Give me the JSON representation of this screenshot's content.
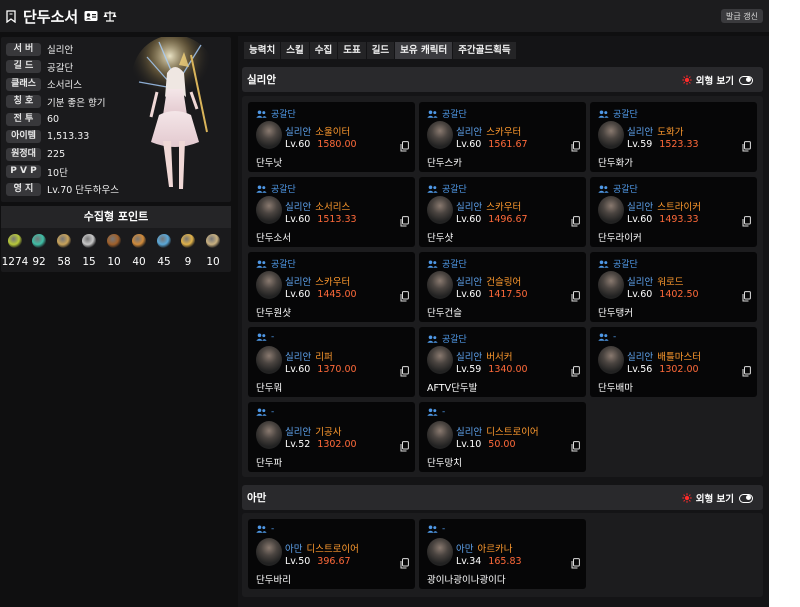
{
  "header": {
    "title": "단두소서",
    "refresh_label": "발급 갱신"
  },
  "profile": {
    "rows": [
      {
        "label": "서 버",
        "value": "실리안"
      },
      {
        "label": "길 드",
        "value": "공갈단"
      },
      {
        "label": "클래스",
        "value": "소서리스"
      },
      {
        "label": "칭 호",
        "value": "기분 좋은 향기"
      },
      {
        "label": "전 투",
        "value": "60"
      },
      {
        "label": "아이템",
        "value": "1,513.33"
      },
      {
        "label": "원정대",
        "value": "225"
      },
      {
        "label": "P V P",
        "value": "10단"
      },
      {
        "label": "영 지",
        "value": "Lv.70 단두하우스"
      }
    ]
  },
  "collection": {
    "title": "수집형 포인트",
    "items": [
      {
        "icon": "seed-icon",
        "value": "1274",
        "color": "#b7c93a"
      },
      {
        "icon": "island-heart-icon",
        "value": "92",
        "color": "#3fbfa6"
      },
      {
        "icon": "art-map-icon",
        "value": "58",
        "color": "#c9a35a"
      },
      {
        "icon": "giant-heart-icon",
        "value": "15",
        "color": "#c7c7c7"
      },
      {
        "icon": "ignea-token-icon",
        "value": "10",
        "color": "#a0602a"
      },
      {
        "icon": "adventure-book-icon",
        "value": "40",
        "color": "#d08a3a"
      },
      {
        "icon": "world-tree-leaf-icon",
        "value": "45",
        "color": "#5aa8d8"
      },
      {
        "icon": "orpheus-star-icon",
        "value": "9",
        "color": "#e0b24a"
      },
      {
        "icon": "sea-bounty-icon",
        "value": "10",
        "color": "#c8b080"
      }
    ]
  },
  "tabs": [
    "능력치",
    "스킬",
    "수집",
    "도표",
    "길드",
    "보유 캐릭터",
    "주간골드획득"
  ],
  "active_tab": "보유 캐릭터",
  "servers": [
    {
      "name": "실리안",
      "toggle_label": "외형 보기",
      "characters": [
        {
          "guild": "공갈단",
          "server": "실리안",
          "class": "소울이터",
          "level": "Lv.60",
          "ilvl": "1580.00",
          "name": "단두낫"
        },
        {
          "guild": "공갈단",
          "server": "실리안",
          "class": "스카우터",
          "level": "Lv.60",
          "ilvl": "1561.67",
          "name": "단두스카"
        },
        {
          "guild": "공갈단",
          "server": "실리안",
          "class": "도화가",
          "level": "Lv.59",
          "ilvl": "1523.33",
          "name": "단두화가"
        },
        {
          "guild": "공갈단",
          "server": "실리안",
          "class": "소서리스",
          "level": "Lv.60",
          "ilvl": "1513.33",
          "name": "단두소서"
        },
        {
          "guild": "공갈단",
          "server": "실리안",
          "class": "스카우터",
          "level": "Lv.60",
          "ilvl": "1496.67",
          "name": "단두샷"
        },
        {
          "guild": "공갈단",
          "server": "실리안",
          "class": "스트라이커",
          "level": "Lv.60",
          "ilvl": "1493.33",
          "name": "단두라이커"
        },
        {
          "guild": "공갈단",
          "server": "실리안",
          "class": "스카우터",
          "level": "Lv.60",
          "ilvl": "1445.00",
          "name": "단두원샷"
        },
        {
          "guild": "공갈단",
          "server": "실리안",
          "class": "건슬링어",
          "level": "Lv.60",
          "ilvl": "1417.50",
          "name": "단두건슬"
        },
        {
          "guild": "공갈단",
          "server": "실리안",
          "class": "워로드",
          "level": "Lv.60",
          "ilvl": "1402.50",
          "name": "단두탱커"
        },
        {
          "guild": "-",
          "server": "실리안",
          "class": "리퍼",
          "level": "Lv.60",
          "ilvl": "1370.00",
          "name": "단두뭐"
        },
        {
          "guild": "공갈단",
          "server": "실리안",
          "class": "버서커",
          "level": "Lv.59",
          "ilvl": "1340.00",
          "name": "AFTV단두발"
        },
        {
          "guild": "-",
          "server": "실리안",
          "class": "배틀마스터",
          "level": "Lv.56",
          "ilvl": "1302.00",
          "name": "단두배마"
        },
        {
          "guild": "-",
          "server": "실리안",
          "class": "기공사",
          "level": "Lv.52",
          "ilvl": "1302.00",
          "name": "단두파"
        },
        {
          "guild": "-",
          "server": "실리안",
          "class": "디스트로이어",
          "level": "Lv.10",
          "ilvl": "50.00",
          "name": "단두망치"
        }
      ]
    },
    {
      "name": "아만",
      "toggle_label": "외형 보기",
      "characters": [
        {
          "guild": "-",
          "server": "아만",
          "class": "디스트로이어",
          "level": "Lv.50",
          "ilvl": "396.67",
          "name": "단두바리"
        },
        {
          "guild": "-",
          "server": "아만",
          "class": "아르카나",
          "level": "Lv.34",
          "ilvl": "165.83",
          "name": "광이나광이나광이다"
        }
      ]
    }
  ]
}
